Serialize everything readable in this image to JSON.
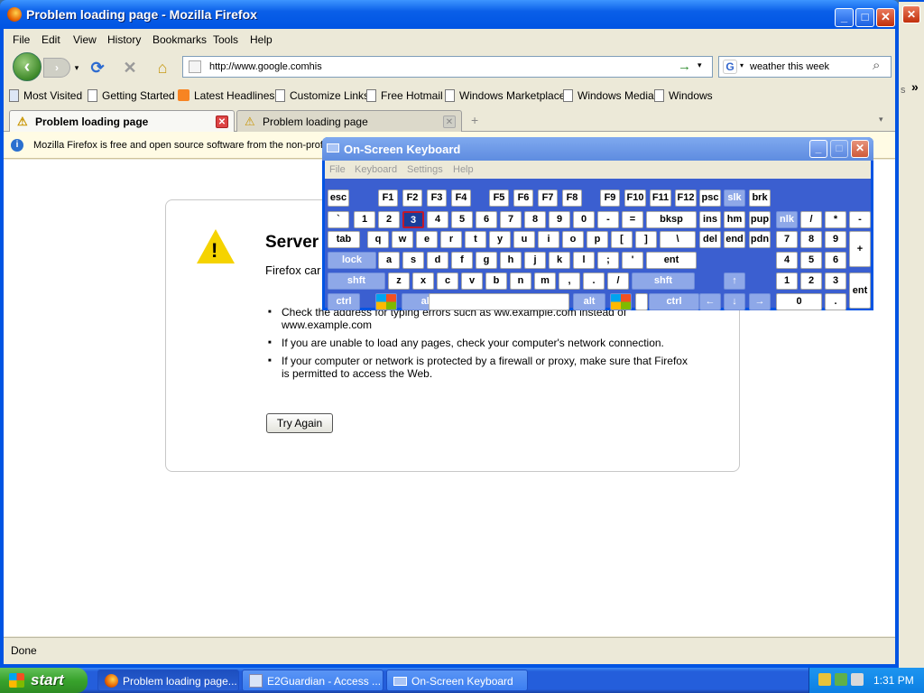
{
  "window": {
    "title": "Problem loading page - Mozilla Firefox",
    "min_label": "_",
    "max_label": "□",
    "close_label": "✕"
  },
  "menu": [
    "File",
    "Edit",
    "View",
    "History",
    "Bookmarks",
    "Tools",
    "Help"
  ],
  "nav": {
    "back": "‹",
    "forward": "›",
    "reload": "⟳",
    "stop": "✕",
    "home": "⌂",
    "url": "http://www.google.comhis",
    "go": "→",
    "dropdown": "▾",
    "search_engine": "G",
    "search_text": "weather this week"
  },
  "bookmarks": [
    "Most Visited",
    "Getting Started",
    "Latest Headlines",
    "Customize Links",
    "Free Hotmail",
    "Windows Marketplace",
    "Windows Media",
    "Windows"
  ],
  "tabs": [
    {
      "label": "Problem loading page",
      "active": true
    },
    {
      "label": "Problem loading page",
      "active": false
    }
  ],
  "tab_new": "+",
  "notification": "Mozilla Firefox is free and open source software from the non-prof",
  "error": {
    "title": "Server",
    "short": "Firefox car",
    "bullets": [
      "Check the address for typing errors such as ww.example.com instead of www.example.com",
      "If you are unable to load any pages, check your computer's network connection.",
      "If your computer or network is protected by a firewall or proxy, make sure that Firefox is permitted to access the Web."
    ],
    "try_again": "Try Again"
  },
  "status": "Done",
  "osk": {
    "title": "On-Screen Keyboard",
    "menu": [
      "File",
      "Keyboard",
      "Settings",
      "Help"
    ],
    "rows": {
      "fn": [
        "esc",
        "F1",
        "F2",
        "F3",
        "F4",
        "F5",
        "F6",
        "F7",
        "F8",
        "F9",
        "F10",
        "F11",
        "F12",
        "psc",
        "slk",
        "brk"
      ],
      "num": [
        "`",
        "1",
        "2",
        "3",
        "4",
        "5",
        "6",
        "7",
        "8",
        "9",
        "0",
        "-",
        "=",
        "bksp",
        "ins",
        "hm",
        "pup",
        "nlk",
        "/",
        "*",
        "-"
      ],
      "q": [
        "tab",
        "q",
        "w",
        "e",
        "r",
        "t",
        "y",
        "u",
        "i",
        "o",
        "p",
        "[",
        "]",
        "\\",
        "del",
        "end",
        "pdn",
        "7",
        "8",
        "9",
        "+"
      ],
      "a": [
        "lock",
        "a",
        "s",
        "d",
        "f",
        "g",
        "h",
        "j",
        "k",
        "l",
        ";",
        "'",
        "ent",
        "4",
        "5",
        "6"
      ],
      "z": [
        "shft",
        "z",
        "x",
        "c",
        "v",
        "b",
        "n",
        "m",
        ",",
        ".",
        "/",
        "shft",
        "↑",
        "1",
        "2",
        "3",
        "ent"
      ],
      "bottom": [
        "ctrl",
        "alt",
        "alt",
        "ctrl",
        "←",
        "↓",
        "→",
        "0",
        "."
      ]
    },
    "selected_key": "3"
  },
  "taskbar": {
    "start": "start",
    "tasks": [
      "Problem loading page...",
      "E2Guardian - Access ...",
      "On-Screen Keyboard"
    ],
    "clock": "1:31 PM"
  },
  "edge": {
    "scroll": "»",
    "s": "s"
  }
}
